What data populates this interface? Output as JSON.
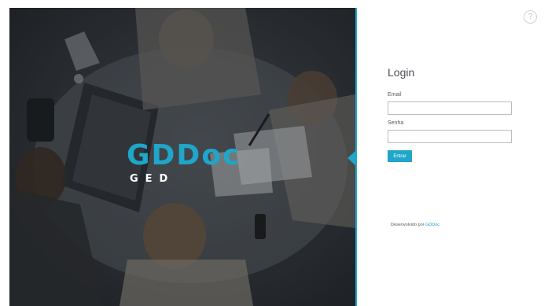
{
  "hero": {
    "brand_name": "GDDoc",
    "brand_sub": "GED"
  },
  "help": {
    "icon": "help-circle-icon",
    "glyph": "?"
  },
  "login": {
    "title": "Login",
    "email_label": "Email",
    "email_value": "",
    "password_label": "Senha",
    "password_value": "",
    "submit_label": "Entrar"
  },
  "footer": {
    "prefix": "Desenvolvido por",
    "link_label": "GDDoc"
  },
  "colors": {
    "accent": "#1fa6c9",
    "panel_dark": "#33373c",
    "text": "#4a4f55"
  }
}
